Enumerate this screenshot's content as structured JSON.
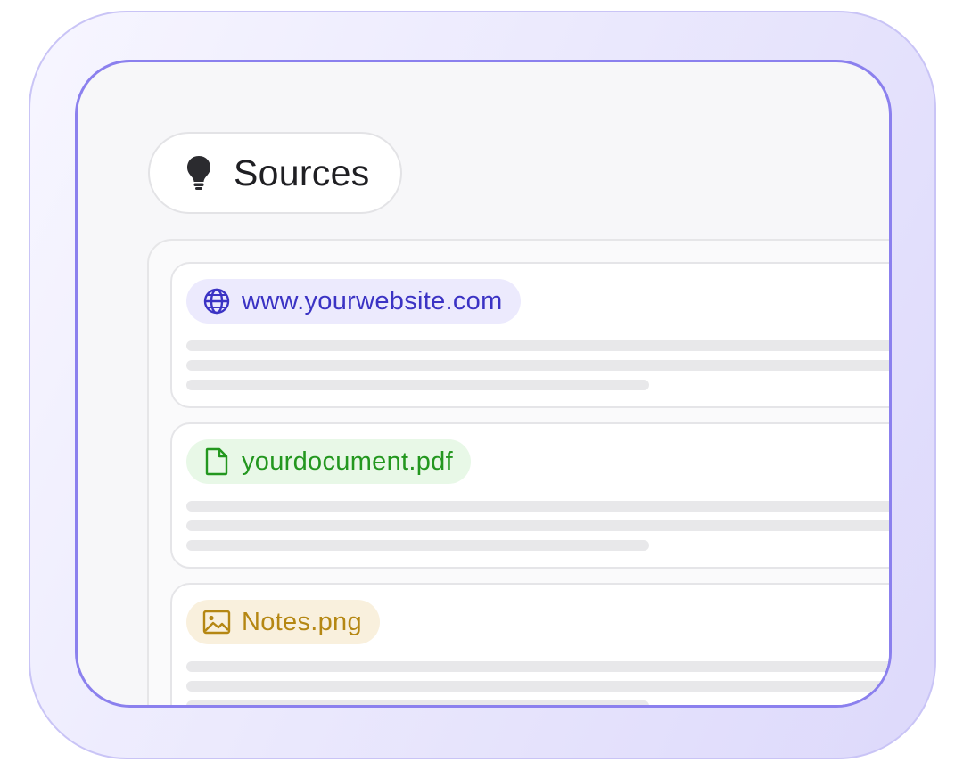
{
  "header": {
    "title": "Sources",
    "icon": "lightbulb-icon"
  },
  "sources": [
    {
      "label": "www.yourwebsite.com",
      "icon": "globe-icon",
      "color": "#3b33c4",
      "bg": "#eceafd"
    },
    {
      "label": "yourdocument.pdf",
      "icon": "document-icon",
      "color": "#23971f",
      "bg": "#e8f8e7"
    },
    {
      "label": "Notes.png",
      "icon": "image-icon",
      "color": "#b58713",
      "bg": "#f9f0dd"
    }
  ],
  "colors": {
    "frame_border": "#8b80ee",
    "frame_glow": "#ddd9fb",
    "placeholder_line": "#e8e8ea"
  }
}
